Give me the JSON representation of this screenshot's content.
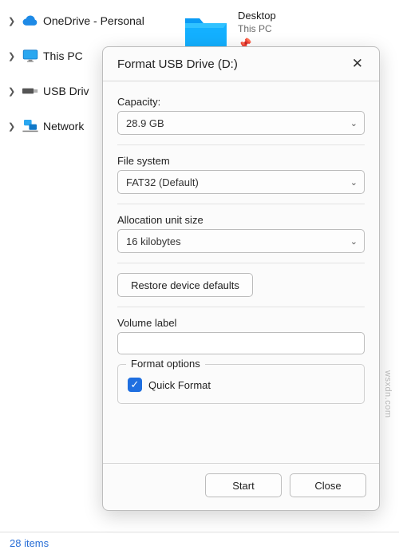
{
  "sidebar": {
    "items": [
      {
        "label": "OneDrive - Personal",
        "icon": "cloud"
      },
      {
        "label": "This PC",
        "icon": "monitor"
      },
      {
        "label": "USB Driv",
        "icon": "usb"
      },
      {
        "label": "Network",
        "icon": "network"
      }
    ]
  },
  "content": {
    "folder_name": "Desktop",
    "folder_location": "This PC"
  },
  "status": {
    "items_text": "28 items"
  },
  "dialog": {
    "title": "Format USB Drive (D:)",
    "capacity_label": "Capacity:",
    "capacity_value": "28.9 GB",
    "fs_label": "File system",
    "fs_value": "FAT32 (Default)",
    "alloc_label": "Allocation unit size",
    "alloc_value": "16 kilobytes",
    "restore_label": "Restore device defaults",
    "volume_label": "Volume label",
    "volume_value": "",
    "format_options_legend": "Format options",
    "quick_format_label": "Quick Format",
    "quick_format_checked": true,
    "start_label": "Start",
    "close_label": "Close"
  },
  "watermark": "wsxdn.com"
}
